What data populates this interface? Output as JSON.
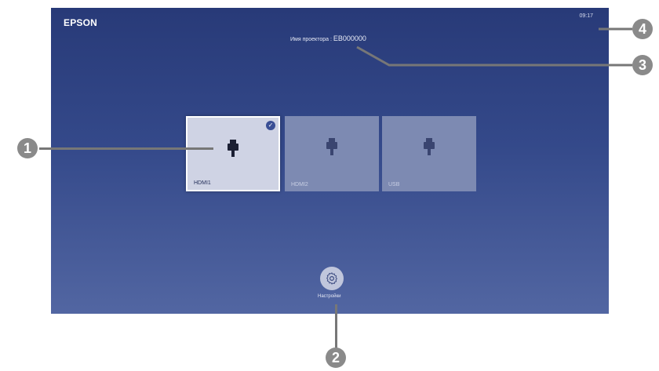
{
  "screen": {
    "brand": "EPSON",
    "clock": "09:17",
    "projector_name_label": "Имя проектора :",
    "projector_name_value": "EB000000"
  },
  "inputs": [
    {
      "label": "HDMI1",
      "selected": true
    },
    {
      "label": "HDMI2",
      "selected": false
    },
    {
      "label": "USB",
      "selected": false
    }
  ],
  "settings": {
    "label": "Настройки"
  },
  "callouts": [
    "1",
    "2",
    "3",
    "4"
  ],
  "colors": {
    "screen_top": "#283a78",
    "screen_bottom": "#5266a2",
    "tile_selected": "#cfd3e4",
    "tile_inactive": "#7d8ab2",
    "marker": "#8a8a8a"
  }
}
